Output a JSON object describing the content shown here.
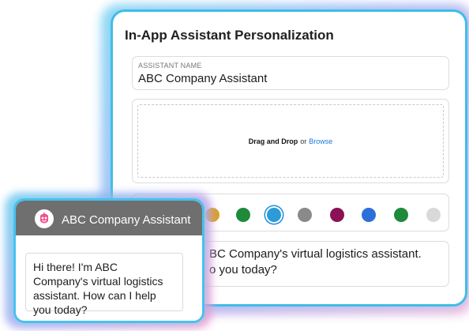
{
  "settings": {
    "title": "In-App Assistant Personalization",
    "name_field": {
      "label": "ASSISTANT NAME",
      "value": "ABC Company Assistant"
    },
    "dropzone": {
      "primary": "Drag and Drop",
      "or": "or",
      "browse": "Browse"
    },
    "colors": [
      "#d6a128",
      "#1e8a3b",
      "#2c9bd8",
      "#8a8a8a",
      "#8b1254",
      "#2c6fd8",
      "#1e8a3b",
      "#d9d9d9"
    ],
    "selected_color": "#2c9bd8",
    "welcome_message_visible": "BC Company's virtual logistics assistant.\no you today?"
  },
  "chat_preview": {
    "title": "ABC Company Assistant",
    "avatar_icon": "robot-face-icon",
    "message": "Hi there! I'm ABC Company's virtual logistics assistant. How can I help you today?"
  }
}
